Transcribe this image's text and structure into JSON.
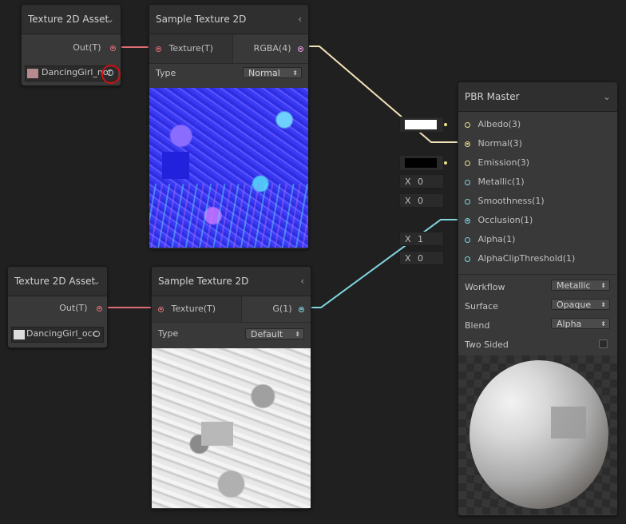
{
  "nodes": {
    "tex_asset_1": {
      "title": "Texture 2D Asset",
      "out_label": "Out(T)",
      "texture_name": "DancingGirl_nor"
    },
    "sample_1": {
      "title": "Sample Texture 2D",
      "in_label": "Texture(T)",
      "out_label": "RGBA(4)",
      "type_label": "Type",
      "type_value": "Normal"
    },
    "tex_asset_2": {
      "title": "Texture 2D Asset",
      "out_label": "Out(T)",
      "texture_name": "DancingGirl_occ"
    },
    "sample_2": {
      "title": "Sample Texture 2D",
      "in_label": "Texture(T)",
      "out_label": "G(1)",
      "type_label": "Type",
      "type_value": "Default"
    },
    "pbr": {
      "title": "PBR Master",
      "ports": [
        {
          "label": "Albedo(3)"
        },
        {
          "label": "Normal(3)"
        },
        {
          "label": "Emission(3)"
        },
        {
          "label": "Metallic(1)"
        },
        {
          "label": "Smoothness(1)"
        },
        {
          "label": "Occlusion(1)"
        },
        {
          "label": "Alpha(1)"
        },
        {
          "label": "AlphaClipThreshold(1)"
        }
      ],
      "inputs": {
        "metallic": {
          "axis": "X",
          "value": "0"
        },
        "smoothness": {
          "axis": "X",
          "value": "0"
        },
        "alpha": {
          "axis": "X",
          "value": "1"
        },
        "alpha_clip": {
          "axis": "X",
          "value": "0"
        }
      },
      "settings": {
        "workflow_label": "Workflow",
        "workflow_value": "Metallic",
        "surface_label": "Surface",
        "surface_value": "Opaque",
        "blend_label": "Blend",
        "blend_value": "Alpha",
        "two_sided_label": "Two Sided"
      }
    }
  },
  "icons": {
    "chevron_down": "⌄",
    "chevron_left": "‹",
    "dropdown_arrow": "⬍"
  },
  "colors": {
    "texture_port": "#e06c75",
    "vector4_port": "#e49ad8",
    "vector3_port": "#e8e18a",
    "float_port": "#7fd6e0",
    "highlight_ring": "#d01010"
  }
}
